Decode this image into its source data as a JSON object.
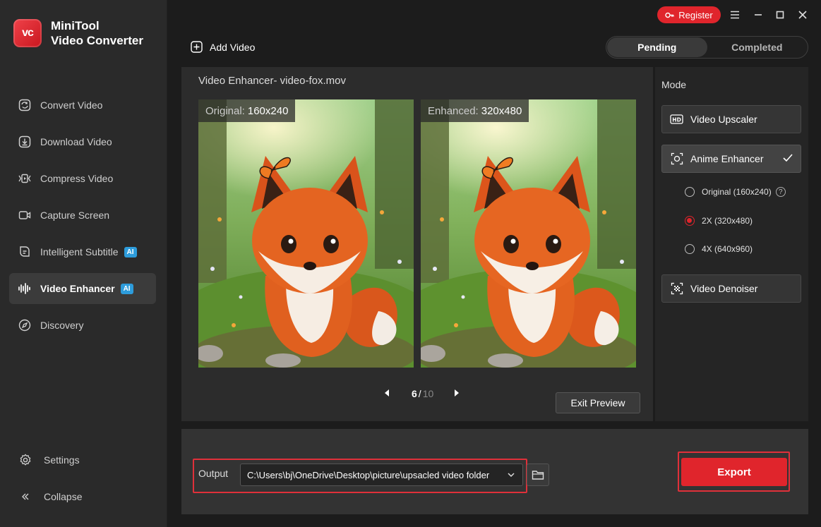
{
  "app": {
    "name_line1": "MiniTool",
    "name_line2": "Video Converter",
    "logo_text": "vc"
  },
  "titlebar": {
    "register_label": "Register"
  },
  "sidebar": {
    "items": [
      {
        "label": "Convert Video",
        "icon": "convert-icon",
        "active": false,
        "ai": false
      },
      {
        "label": "Download Video",
        "icon": "download-icon",
        "active": false,
        "ai": false
      },
      {
        "label": "Compress Video",
        "icon": "compress-icon",
        "active": false,
        "ai": false
      },
      {
        "label": "Capture Screen",
        "icon": "camera-icon",
        "active": false,
        "ai": false
      },
      {
        "label": "Intelligent Subtitle",
        "icon": "subtitle-icon",
        "active": false,
        "ai": true
      },
      {
        "label": "Video Enhancer",
        "icon": "waveform-icon",
        "active": true,
        "ai": true
      },
      {
        "label": "Discovery",
        "icon": "compass-icon",
        "active": false,
        "ai": false
      }
    ],
    "ai_badge": "AI",
    "settings_label": "Settings",
    "collapse_label": "Collapse"
  },
  "toolbar": {
    "add_video_label": "Add Video",
    "tabs": [
      {
        "label": "Pending",
        "active": true
      },
      {
        "label": "Completed",
        "active": false
      }
    ]
  },
  "preview": {
    "title": "Video Enhancer- video-fox.mov",
    "original_label": "Original:",
    "original_res": "160x240",
    "enhanced_label": "Enhanced:",
    "enhanced_res": "320x480",
    "page_current": "6",
    "page_sep": "/",
    "page_total": "10",
    "exit_label": "Exit Preview"
  },
  "mode": {
    "title": "Mode",
    "upscaler_label": "Video Upscaler",
    "anime_label": "Anime Enhancer",
    "denoiser_label": "Video Denoiser",
    "options": [
      {
        "label": "Original (160x240)",
        "selected": false,
        "help": true
      },
      {
        "label": "2X (320x480)",
        "selected": true,
        "help": false
      },
      {
        "label": "4X (640x960)",
        "selected": false,
        "help": false
      }
    ]
  },
  "output": {
    "label": "Output",
    "path": "C:\\Users\\bj\\OneDrive\\Desktop\\picture\\upsacled video folder",
    "export_label": "Export"
  },
  "colors": {
    "accent": "#e0252c",
    "ai_badge": "#2d9cdb"
  }
}
